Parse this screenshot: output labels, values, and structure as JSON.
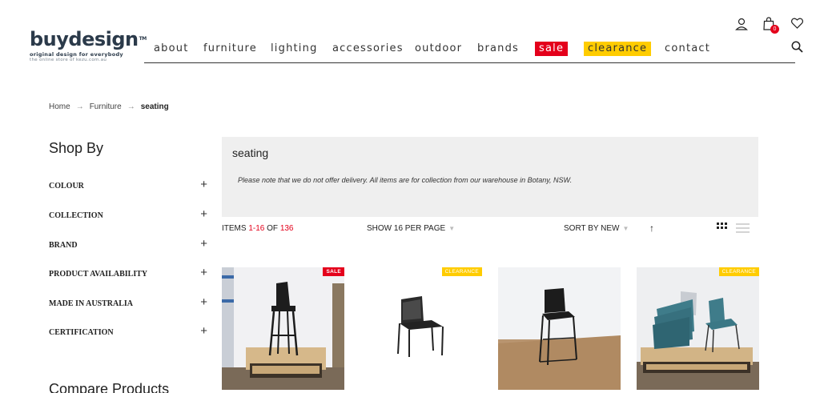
{
  "logo": {
    "name": "buydesign",
    "tm": "TM",
    "tagline": "original design for everybody",
    "subline": "the online store of kezu.com.au"
  },
  "nav": {
    "items": [
      "about",
      "furniture",
      "lighting",
      "accessories",
      "outdoor",
      "brands",
      "sale",
      "clearance",
      "contact"
    ]
  },
  "header_icons": {
    "account": "user-icon",
    "cart": "shopping-bag-icon",
    "cart_count": "0",
    "wishlist": "heart-icon",
    "search": "search-icon"
  },
  "breadcrumb": {
    "items": [
      "Home",
      "Furniture",
      "seating"
    ]
  },
  "sidebar": {
    "title": "Shop By",
    "filters": [
      "COLOUR",
      "COLLECTION",
      "BRAND",
      "PRODUCT AVAILABILITY",
      "MADE IN AUSTRALIA",
      "CERTIFICATION"
    ],
    "compare_title": "Compare Products"
  },
  "category": {
    "title": "seating",
    "note": "Please note that we do not offer delivery. All items are for collection from our warehouse in Botany, NSW."
  },
  "toolbar": {
    "items_prefix": "ITEMS ",
    "items_range": "1-16",
    "items_of": " OF ",
    "items_total": "136",
    "show_label": "SHOW 16 PER PAGE",
    "sort_label": "SORT BY NEW"
  },
  "products": [
    {
      "badge": "SALE",
      "badge_type": "sale"
    },
    {
      "badge": "CLEARANCE",
      "badge_type": "clearance"
    },
    {
      "badge": "",
      "badge_type": ""
    },
    {
      "badge": "CLEARANCE",
      "badge_type": "clearance"
    }
  ],
  "colors": {
    "sale_red": "#e4001b",
    "clearance_yellow": "#ffcc00",
    "banner_bg": "#efefef"
  }
}
